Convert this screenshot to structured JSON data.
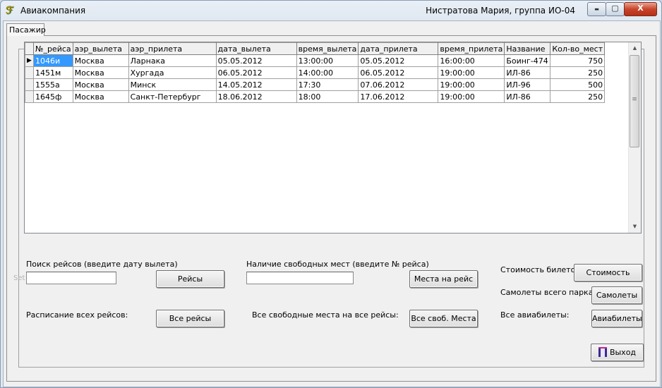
{
  "window": {
    "title": "Авиакомпания",
    "title_right": "Нистратова Мария,  группа ИО-04",
    "controls": {
      "minimize": "▬",
      "maximize": "▢",
      "close": "X"
    }
  },
  "tabs": [
    {
      "label": "Пасажир",
      "active": true
    }
  ],
  "grid": {
    "columns": [
      "№_рейса",
      "аэр_вылета",
      "аэр_прилета",
      "дата_вылета",
      "время_вылета",
      "дата_прилета",
      "время_прилета",
      "Название",
      "Кол-во_мест"
    ],
    "rows": [
      [
        "1046и",
        "Москва",
        "Ларнака",
        "05.05.2012",
        "13:00:00",
        "05.05.2012",
        "16:00:00",
        "Боинг-474",
        "750"
      ],
      [
        "1451м",
        "Москва",
        "Хургада",
        "06.05.2012",
        "14:00:00",
        "06.05.2012",
        "19:00:00",
        "ИЛ-86",
        "250"
      ],
      [
        "1555а",
        "Москва",
        "Минск",
        "14.05.2012",
        "17:30",
        "07.06.2012",
        "19:00:00",
        "ИЛ-96",
        "500"
      ],
      [
        "1645ф",
        "Москва",
        "Санкт-Петербург",
        "18.06.2012",
        "18:00",
        "17.06.2012",
        "19:00:00",
        "ИЛ-86",
        "250"
      ]
    ],
    "current_row_marker": "▶"
  },
  "search": {
    "label": "Поиск рейсов (введите дату вылета)",
    "ghost_text": "Set",
    "input_value": "",
    "button": "Рейсы"
  },
  "free_seats": {
    "label": "Наличие свободных мест (введите № рейса)",
    "input_value": "",
    "button": "Места на рейс"
  },
  "schedule": {
    "label": "Расписание всех рейсов:",
    "button": "Все рейсы"
  },
  "all_free": {
    "label": "Все свободные места на все рейсы:",
    "button": "Все своб. Места"
  },
  "cost": {
    "label": "Стоимость билетов:",
    "button": "Стоимость"
  },
  "fleet": {
    "label": "Самолеты всего парка:",
    "button": "Самолеты"
  },
  "tickets": {
    "label": "Все авиабилеты:",
    "button": "Авиабилеты"
  },
  "exit": {
    "button": "Выход"
  }
}
